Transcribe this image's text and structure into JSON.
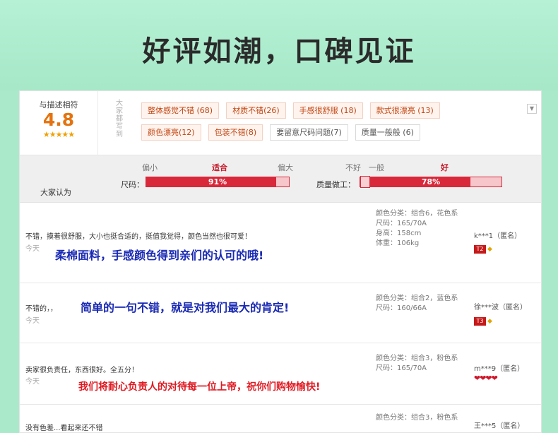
{
  "banner": {
    "title": "好评如潮，口碑见证"
  },
  "score": {
    "label": "与描述相符",
    "value": "4.8",
    "stars": "★★★★★"
  },
  "tag_cloud": {
    "vertical_label": "大家都写到",
    "tags": [
      {
        "label": "整体感觉不错 (68)",
        "positive": true
      },
      {
        "label": "材质不错(26)",
        "positive": true
      },
      {
        "label": "手感很舒服 (18)",
        "positive": true
      },
      {
        "label": "款式很漂亮 (13)",
        "positive": true
      },
      {
        "label": "颜色漂亮(12)",
        "positive": true
      },
      {
        "label": "包装不错(8)",
        "positive": true
      },
      {
        "label": "要留意尺码问题(7)",
        "positive": false
      },
      {
        "label": "质量一般般 (6)",
        "positive": false
      }
    ],
    "expand_icon": "chevron-down-icon"
  },
  "opinion": {
    "label": "大家认为",
    "size": {
      "label": "尺码：",
      "ticks": [
        "偏小",
        "适合",
        "偏大"
      ],
      "percent_text": "91%",
      "percent": 91
    },
    "quality": {
      "label": "质量做工：",
      "ticks": [
        "不好",
        "一般",
        "好"
      ],
      "percent_text": "78%",
      "percent": 78
    }
  },
  "reviews": [
    {
      "text": "不错，摸着很舒服，大小也挺合适的，挺值我觉得，颜色当然也很可爱！",
      "date": "今天",
      "overlay": "柔棉面料，手感颜色得到亲们的认可的哦!",
      "sku": [
        "颜色分类：组合6，花色系",
        "尺码：165/70A",
        "身高：158cm",
        "体重：106kg"
      ],
      "user": "k***1（匿名）",
      "level": "T2"
    },
    {
      "text": "不错的，，",
      "date": "今天",
      "overlay": "简单的一句不错，就是对我们最大的肯定!",
      "sku": [
        "颜色分类：组合2，蓝色系",
        "尺码：160/66A"
      ],
      "user": "徐***波（匿名）",
      "level": "T3"
    },
    {
      "text": "卖家很负责任，东西很好。全五分！",
      "date": "今天",
      "overlay": "我们将耐心负责人的对待每一位上帝，祝你们购物愉快!",
      "sku": [
        "颜色分类：组合3，粉色系",
        "尺码：165/70A"
      ],
      "user": "m***9（匿名）",
      "hearts": "❤❤❤❤"
    },
    {
      "text": "没有色差...看起来还不错",
      "sku": [
        "颜色分类：组合3，粉色系"
      ],
      "user": "王***5（匿名）"
    }
  ]
}
